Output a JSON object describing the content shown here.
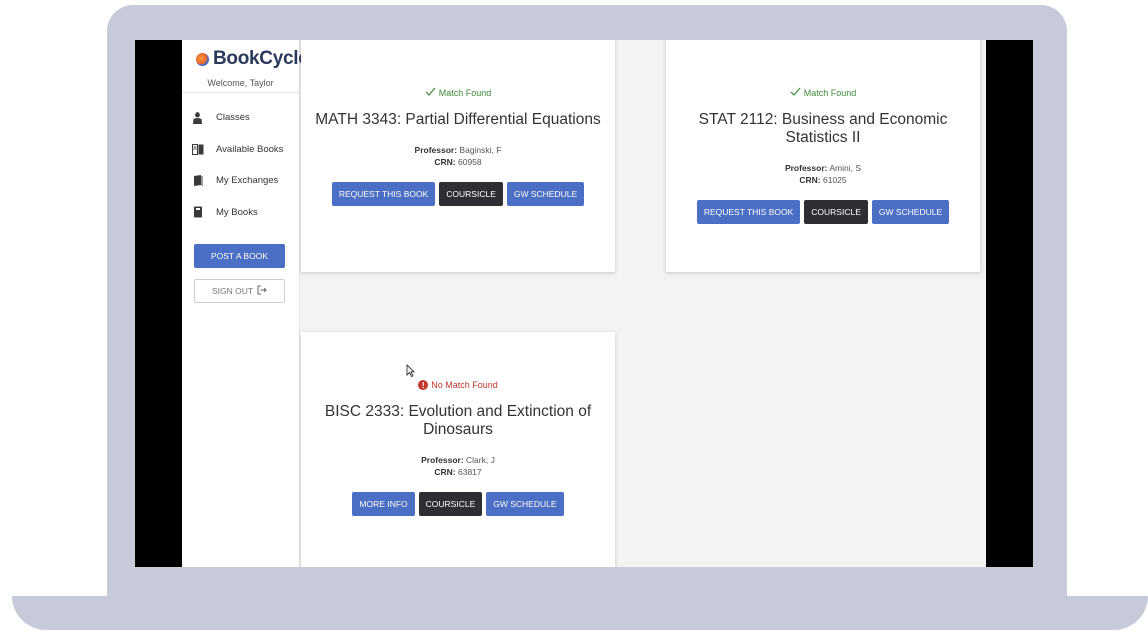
{
  "app": {
    "brand": "BookCycle",
    "welcome": "Welcome, Taylor"
  },
  "sidebar": {
    "items": [
      {
        "label": "Classes",
        "icon": "student-icon"
      },
      {
        "label": "Available Books",
        "icon": "books-icon"
      },
      {
        "label": "My Exchanges",
        "icon": "exchange-book-icon"
      },
      {
        "label": "My Books",
        "icon": "book-icon"
      }
    ],
    "post_label": "POST A BOOK",
    "signout_label": "SIGN OUT",
    "signout_icon": "sign-out-icon"
  },
  "cards": [
    {
      "status": "Match Found",
      "status_type": "match",
      "title": "MATH 3343: Partial Differential Equations",
      "professor_label": "Professor:",
      "professor": "Baginski, F",
      "crn_label": "CRN:",
      "crn": "60958",
      "buttons": [
        "REQUEST THIS BOOK",
        "COURSICLE",
        "GW SCHEDULE"
      ]
    },
    {
      "status": "Match Found",
      "status_type": "match",
      "title": "STAT 2112: Business and Economic Statistics II",
      "professor_label": "Professor:",
      "professor": "Amini, S",
      "crn_label": "CRN:",
      "crn": "61025",
      "buttons": [
        "REQUEST THIS BOOK",
        "COURSICLE",
        "GW SCHEDULE"
      ]
    },
    {
      "status": "No Match Found",
      "status_type": "no-match",
      "title": "BISC 2333: Evolution and Extinction of Dinosaurs",
      "professor_label": "Professor:",
      "professor": "Clark, J",
      "crn_label": "CRN:",
      "crn": "63817",
      "buttons": [
        "MORE INFO",
        "COURSICLE",
        "GW SCHEDULE"
      ]
    }
  ],
  "colors": {
    "primary": "#4a6fc4",
    "dark_button": "#2e2f33",
    "match": "#3f8a3a",
    "no_match": "#c0392b"
  }
}
